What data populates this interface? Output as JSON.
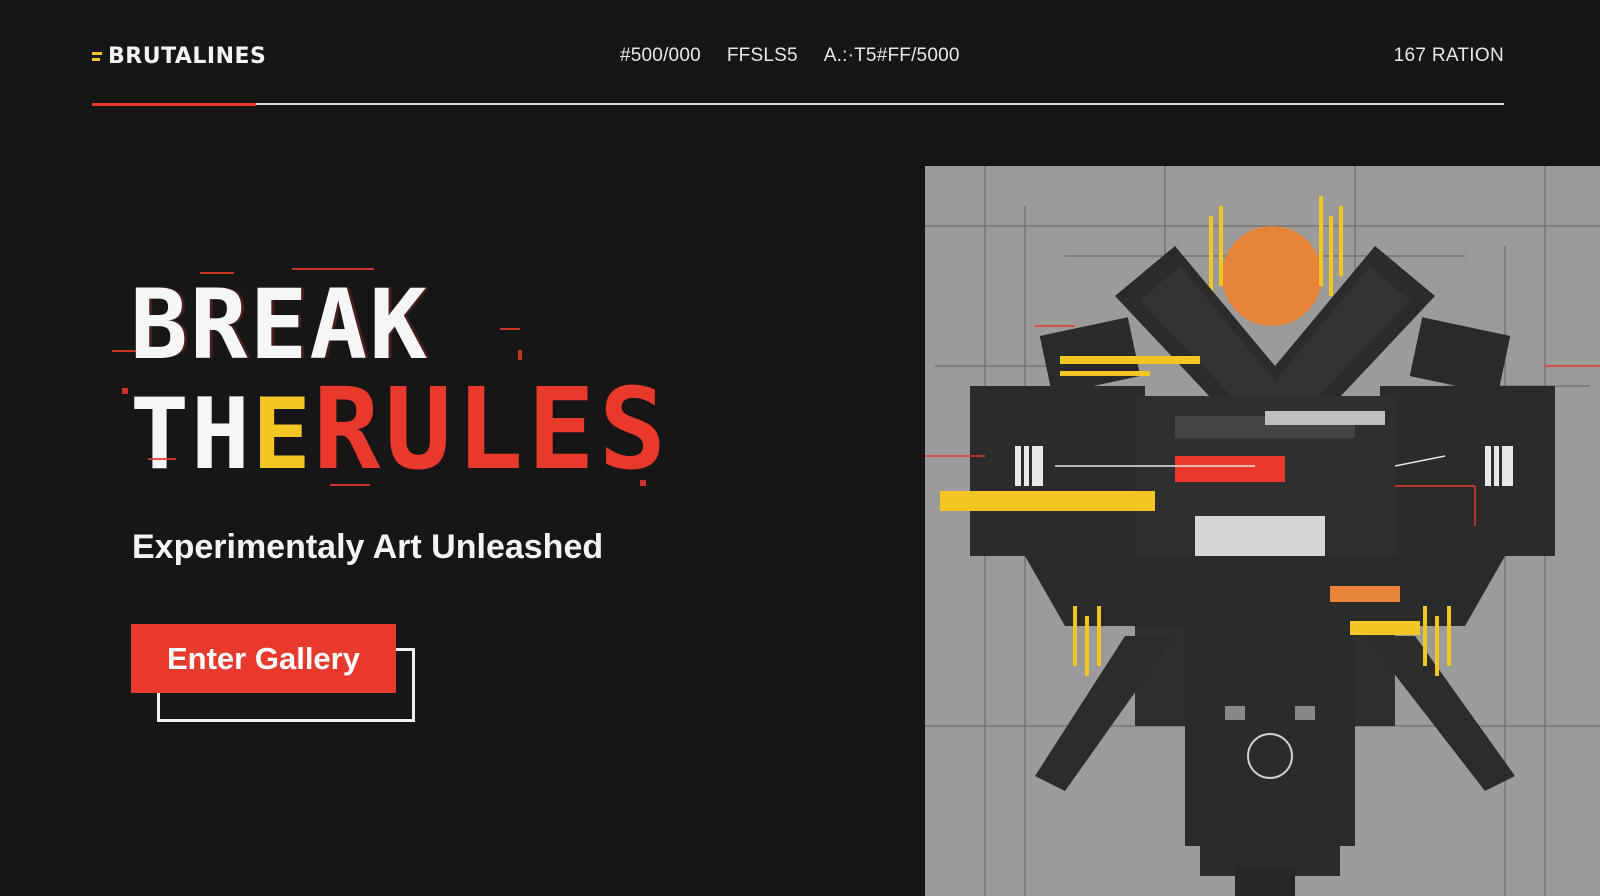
{
  "brand": {
    "name": "BRUTALINES",
    "accent_color": "#f3c623"
  },
  "nav": {
    "items": [
      "#500/000",
      "FFSLS5",
      "A.:·T5#FF/5000"
    ]
  },
  "header_right": "167 RATION",
  "hero": {
    "line1": "BREAK",
    "line2_th": "TH",
    "line2_e": "E",
    "line2_rules": "RULES",
    "subtitle": "Experimentaly Art Unleashed",
    "cta_label": "Enter Gallery"
  },
  "artwork": {
    "subject": "brutalist-mechanical-artwork"
  },
  "colors": {
    "background": "#161616",
    "red": "#e8392d",
    "yellow": "#f3c623",
    "art_bg": "#9b9b9b"
  }
}
